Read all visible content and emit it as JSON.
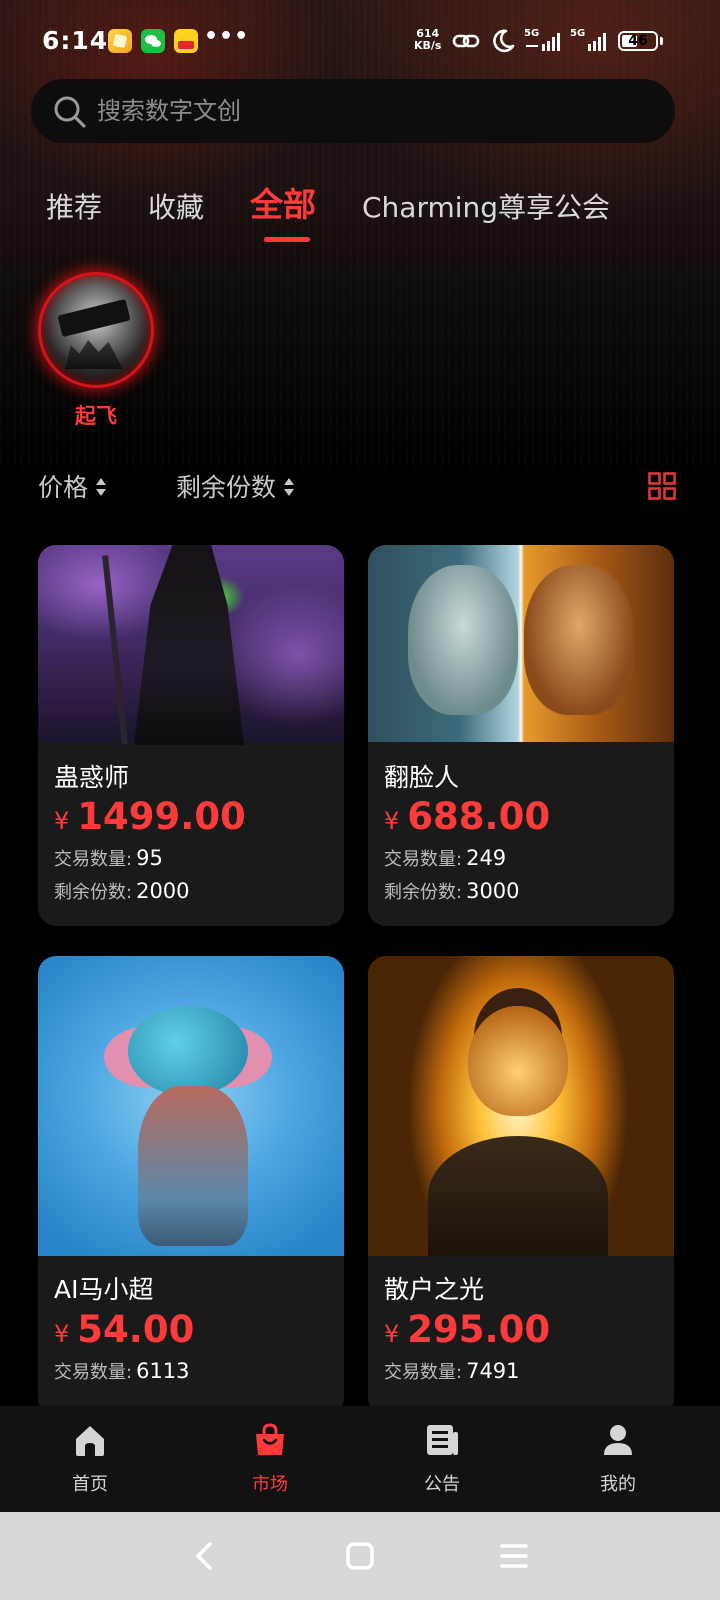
{
  "status_bar": {
    "time": "6:14",
    "more": "•••",
    "speed_value": "614",
    "speed_unit": "KB/s",
    "network_1": "5G",
    "network_2": "5G",
    "battery": "46",
    "battery_level": 0.46,
    "app_icons": [
      "notes-app-icon",
      "wechat-icon",
      "cat-app-icon"
    ]
  },
  "search": {
    "placeholder": "搜索数字文创",
    "value": ""
  },
  "tabs": [
    {
      "label": "推荐",
      "active": false
    },
    {
      "label": "收藏",
      "active": false
    },
    {
      "label": "全部",
      "active": true
    },
    {
      "label": "Charming尊享公会",
      "active": false
    }
  ],
  "guild": {
    "label": "起飞"
  },
  "sort": {
    "price_label": "价格",
    "remaining_label": "剩余份数",
    "view_icon": "grid-view-icon"
  },
  "products": [
    {
      "name": "蛊惑师",
      "currency": "¥",
      "price": "1499.00",
      "trade_label": "交易数量:",
      "trade_count": "95",
      "remaining_label": "剩余份数:",
      "remaining_count": "2000"
    },
    {
      "name": "翻脸人",
      "currency": "¥",
      "price": "688.00",
      "trade_label": "交易数量:",
      "trade_count": "249",
      "remaining_label": "剩余份数:",
      "remaining_count": "3000"
    },
    {
      "name": "AI马小超",
      "currency": "¥",
      "price": "54.00",
      "trade_label": "交易数量:",
      "trade_count": "6113"
    },
    {
      "name": "散户之光",
      "currency": "¥",
      "price": "295.00",
      "trade_label": "交易数量:",
      "trade_count": "7491"
    }
  ],
  "bottom_nav": [
    {
      "label": "首页",
      "icon": "home-icon",
      "active": false
    },
    {
      "label": "市场",
      "icon": "shopping-bag-icon",
      "active": true
    },
    {
      "label": "公告",
      "icon": "news-icon",
      "active": false
    },
    {
      "label": "我的",
      "icon": "person-icon",
      "active": false
    }
  ],
  "colors": {
    "accent": "#ff3a3a",
    "background": "#000000",
    "card": "#1a1a1a"
  }
}
